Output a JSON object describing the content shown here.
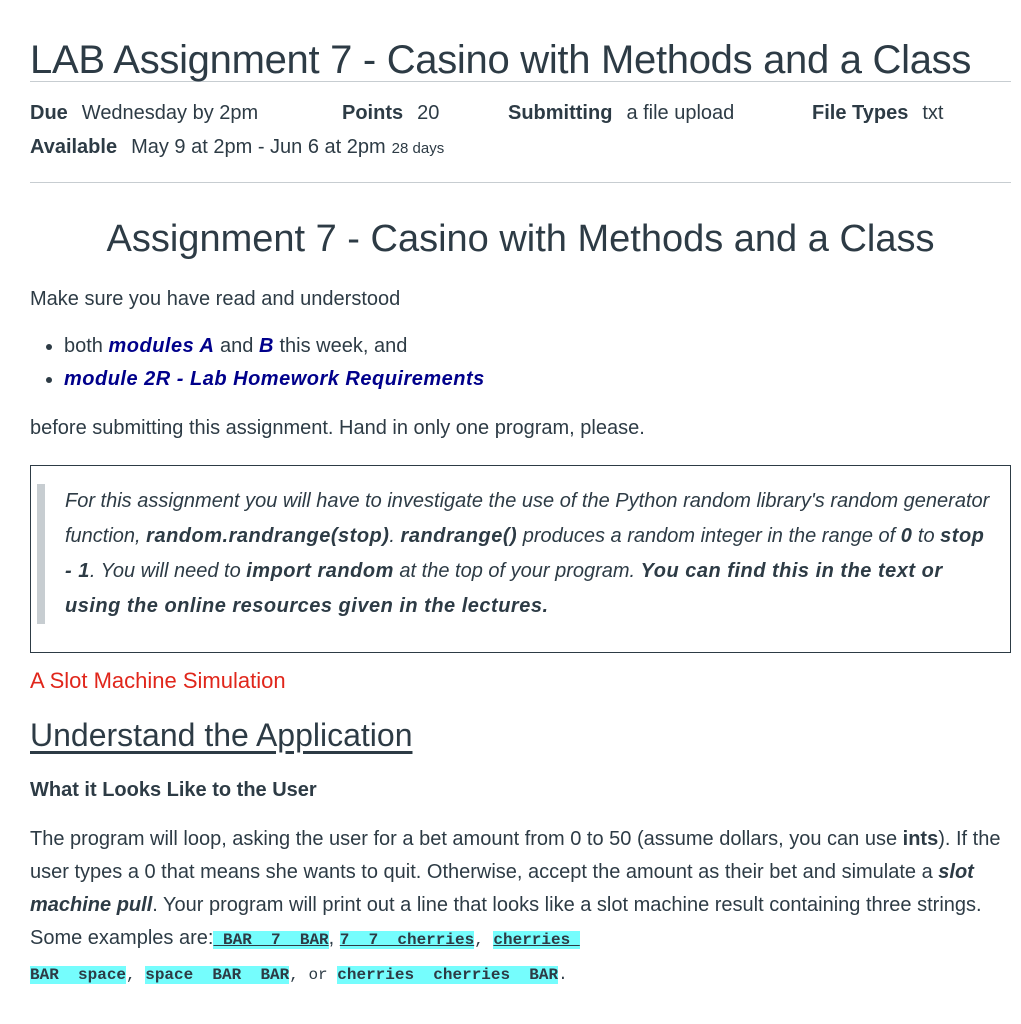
{
  "title": "LAB Assignment 7 - Casino with Methods and a Class",
  "details": {
    "due_label": "Due",
    "due_value": "Wednesday by 2pm",
    "points_label": "Points",
    "points_value": "20",
    "submitting_label": "Submitting",
    "submitting_value": "a file upload",
    "filetypes_label": "File Types",
    "filetypes_value": "txt",
    "available_label": "Available",
    "available_value": "May 9 at 2pm - Jun 6 at 2pm",
    "available_days": "28 days"
  },
  "content": {
    "heading": "Assignment 7 - Casino with Methods and a Class",
    "intro": "Make sure you have read and understood",
    "list": {
      "item1_pre": "both ",
      "item1_link1": "modules A",
      "item1_mid": " and ",
      "item1_link2": "B",
      "item1_post": " this week, and",
      "item2_link": "module 2R - Lab Homework Requirements"
    },
    "before": "before submitting this assignment. Hand in only one program, please.",
    "note": {
      "t1": "For this assignment you will have to investigate the use of the Python random library's random generator function, ",
      "b1": "random.randrange(stop)",
      "t2": ".  ",
      "b2": "randrange()",
      "t3": " produces a random integer in the range of ",
      "b3": "0",
      "t4": " to ",
      "b4": "stop - 1",
      "t5": ".  You will need to ",
      "b5": "import random",
      "t6": " at the top of your program. ",
      "b6": "You can find this in the text or using the online resources given in the lectures."
    },
    "section_red": "A Slot Machine Simulation",
    "section_h3": "Understand the Application",
    "section_h4": "What it Looks Like to the User",
    "para": {
      "t1": "The program will loop, asking the user for a bet amount from 0 to 50  (assume dollars, you can use ",
      "b1": "ints",
      "t2": ").  If the user types a 0 that means she wants to quit.  Otherwise, accept the amount as their bet and simulate a ",
      "bi1": "slot machine pull",
      "t3": ".  Your program will print out a line that looks like a slot machine result containing three strings.  Some examples are:",
      "ex1": " BAR  7  BAR",
      "sep1": ", ",
      "ex2": "7  7  cherries",
      "sep2": ", ",
      "ex3a": "cherries ",
      "ex3b": "BAR  space",
      "sep3": ", ",
      "ex4": "space  BAR  BAR",
      "sep4": ", or ",
      "ex5": "cherries  cherries  BAR",
      "end": "."
    }
  },
  "colors": {
    "text": "#2d3b45",
    "link": "#00008b",
    "red_heading": "#e0261b",
    "code_highlight": "#75fdfd",
    "rule": "#c7cdd1"
  }
}
